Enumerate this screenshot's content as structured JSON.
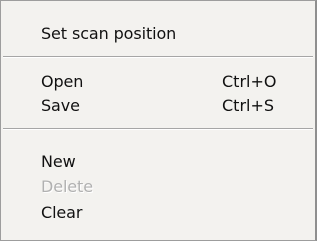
{
  "menu": {
    "items": [
      {
        "label": "Set scan position",
        "shortcut": "",
        "enabled": true
      },
      {
        "label": "Open",
        "shortcut": "Ctrl+O",
        "enabled": true
      },
      {
        "label": "Save",
        "shortcut": "Ctrl+S",
        "enabled": true
      },
      {
        "label": "New",
        "shortcut": "",
        "enabled": true
      },
      {
        "label": "Delete",
        "shortcut": "",
        "enabled": false
      },
      {
        "label": "Clear",
        "shortcut": "",
        "enabled": true
      }
    ]
  }
}
